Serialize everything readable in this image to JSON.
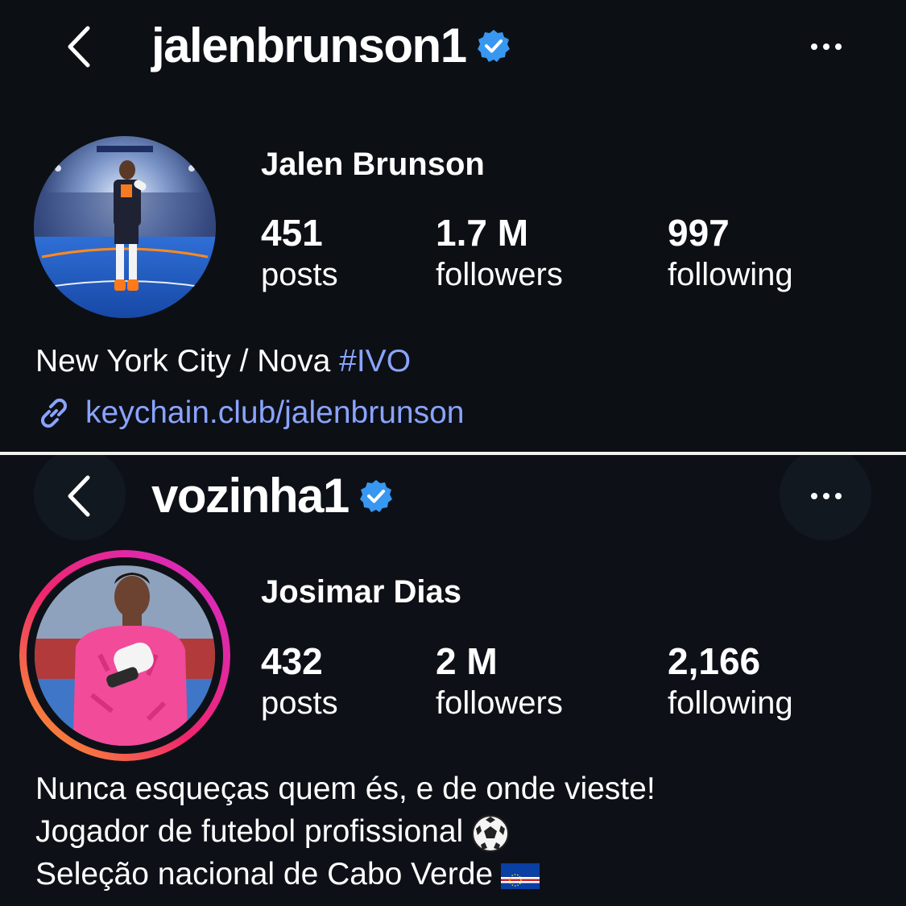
{
  "profiles": [
    {
      "handle": "jalenbrunson1",
      "verified": true,
      "display_name": "Jalen Brunson",
      "stats": [
        {
          "value": "451",
          "label": "posts"
        },
        {
          "value": "1.7 M",
          "label": "followers"
        },
        {
          "value": "997",
          "label": "following"
        }
      ],
      "bio_text": "New York City / Nova ",
      "bio_hashtag": "#IVO",
      "link": "keychain.club/jalenbrunson"
    },
    {
      "handle": "vozinha1",
      "verified": true,
      "has_story_ring": true,
      "display_name": "Josimar Dias",
      "stats": [
        {
          "value": "432",
          "label": "posts"
        },
        {
          "value": "2 M",
          "label": "followers"
        },
        {
          "value": "2,166",
          "label": "following"
        }
      ],
      "bio_lines": [
        "Nunca esqueças quem és, e de onde vieste!",
        "Jogador de futebol profissional",
        "Seleção nacional de Cabo Verde"
      ]
    }
  ],
  "icons": {
    "back": "chevron-left-icon",
    "more": "more-horizontal-icon",
    "verified": "verified-badge-icon",
    "link": "link-icon",
    "soccer_ball": "soccer-ball-emoji",
    "flag": "cape-verde-flag-emoji"
  },
  "colors": {
    "background": "#0c0f14",
    "link": "#8aa3ff",
    "verified": "#3897f0",
    "story_ring_start": "#f9a825",
    "story_ring_end": "#d42bd1"
  }
}
